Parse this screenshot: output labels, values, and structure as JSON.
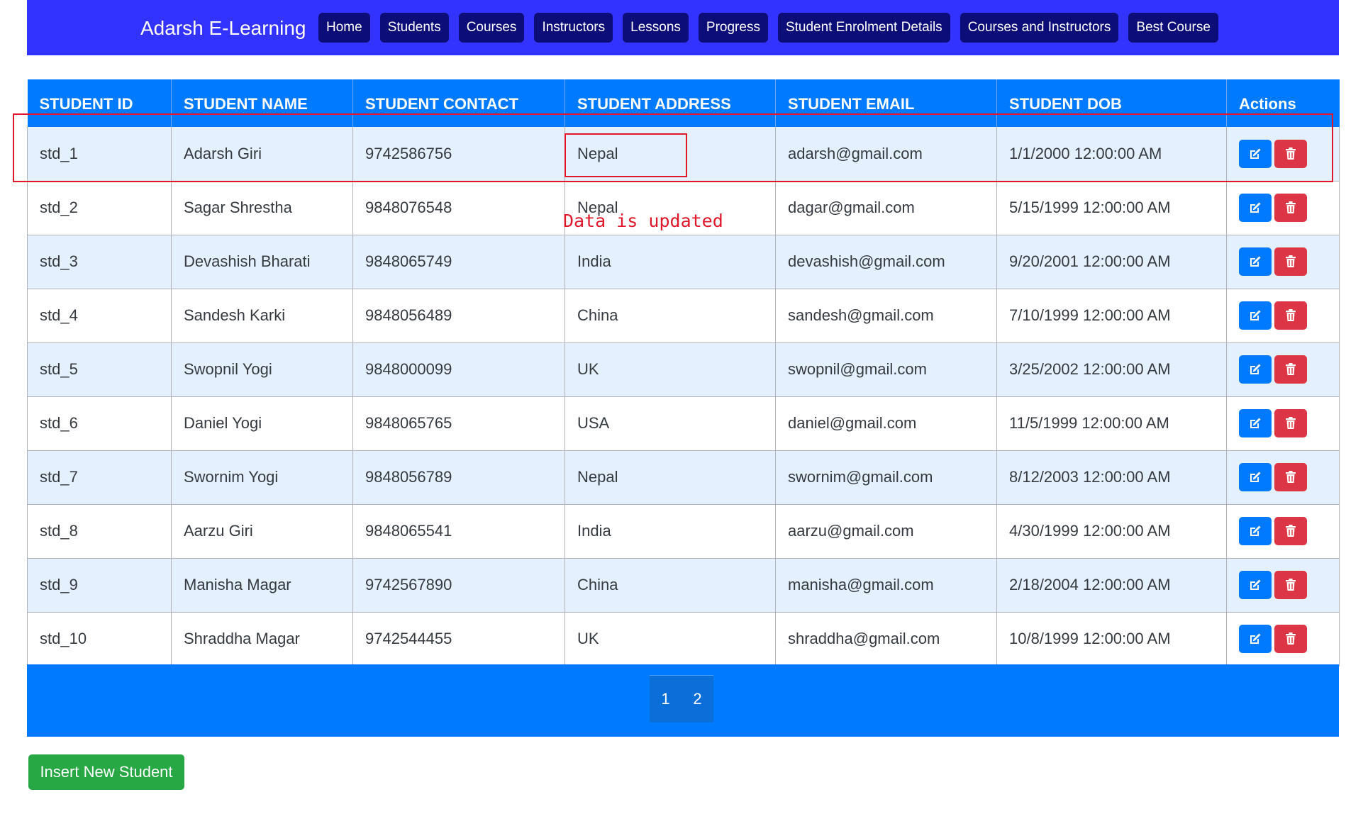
{
  "navbar": {
    "brand": "Adarsh E-Learning",
    "items": [
      "Home",
      "Students",
      "Courses",
      "Instructors",
      "Lessons",
      "Progress",
      "Student Enrolment Details",
      "Courses and Instructors",
      "Best Course"
    ]
  },
  "table": {
    "headers": [
      "STUDENT ID",
      "STUDENT NAME",
      "STUDENT CONTACT",
      "STUDENT ADDRESS",
      "STUDENT EMAIL",
      "STUDENT DOB",
      "Actions"
    ],
    "rows": [
      [
        "std_1",
        "Adarsh Giri",
        "9742586756",
        "Nepal",
        "adarsh@gmail.com",
        "1/1/2000 12:00:00 AM"
      ],
      [
        "std_2",
        "Sagar Shrestha",
        "9848076548",
        "Nepal",
        "dagar@gmail.com",
        "5/15/1999 12:00:00 AM"
      ],
      [
        "std_3",
        "Devashish Bharati",
        "9848065749",
        "India",
        "devashish@gmail.com",
        "9/20/2001 12:00:00 AM"
      ],
      [
        "std_4",
        "Sandesh Karki",
        "9848056489",
        "China",
        "sandesh@gmail.com",
        "7/10/1999 12:00:00 AM"
      ],
      [
        "std_5",
        "Swopnil Yogi",
        "9848000099",
        "UK",
        "swopnil@gmail.com",
        "3/25/2002 12:00:00 AM"
      ],
      [
        "std_6",
        "Daniel Yogi",
        "9848065765",
        "USA",
        "daniel@gmail.com",
        "11/5/1999 12:00:00 AM"
      ],
      [
        "std_7",
        "Swornim Yogi",
        "9848056789",
        "Nepal",
        "swornim@gmail.com",
        "8/12/2003 12:00:00 AM"
      ],
      [
        "std_8",
        "Aarzu Giri",
        "9848065541",
        "India",
        "aarzu@gmail.com",
        "4/30/1999 12:00:00 AM"
      ],
      [
        "std_9",
        "Manisha Magar",
        "9742567890",
        "China",
        "manisha@gmail.com",
        "2/18/2004 12:00:00 AM"
      ],
      [
        "std_10",
        "Shraddha Magar",
        "9742544455",
        "UK",
        "shraddha@gmail.com",
        "10/8/1999 12:00:00 AM"
      ]
    ]
  },
  "pagination": {
    "pages": [
      "1",
      "2"
    ]
  },
  "insert_button": "Insert New Student",
  "annotation": {
    "text": "Data is updated"
  },
  "colors": {
    "navbar": "#3333ff",
    "nav_button": "#0d0d7a",
    "table_header": "#007bff",
    "row_stripe": "#e5f0ff",
    "edit_button": "#007bff",
    "delete_button": "#dc3545",
    "insert_button": "#28a745",
    "annotation": "#e0162b"
  },
  "icons": {
    "edit": "edit-icon",
    "delete": "trash-icon"
  }
}
